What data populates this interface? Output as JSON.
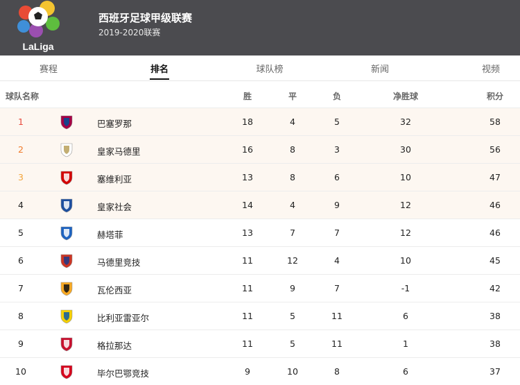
{
  "header": {
    "title": "西班牙足球甲级联赛",
    "season": "2019-2020联赛",
    "logo_text": "LaLiga"
  },
  "tabs": [
    {
      "label": "赛程",
      "active": false
    },
    {
      "label": "排名",
      "active": true
    },
    {
      "label": "球队榜",
      "active": false
    },
    {
      "label": "新闻",
      "active": false
    },
    {
      "label": "视频",
      "active": false
    }
  ],
  "columns": {
    "team": "球队名称",
    "win": "胜",
    "draw": "平",
    "loss": "负",
    "goal_diff": "净胜球",
    "points": "积分"
  },
  "colors": {
    "header_bg": "#4b4b4f",
    "rank_1": "#e8483c",
    "rank_2": "#f07a2a",
    "rank_3": "#f3a43a",
    "top_row_bg": "#fdf7f1"
  },
  "rows": [
    {
      "rank": "1",
      "team": "巴塞罗那",
      "crest": "barcelona-crest-icon",
      "w": "18",
      "d": "4",
      "l": "5",
      "gd": "32",
      "pts": "58"
    },
    {
      "rank": "2",
      "team": "皇家马德里",
      "crest": "real-madrid-crest-icon",
      "w": "16",
      "d": "8",
      "l": "3",
      "gd": "30",
      "pts": "56"
    },
    {
      "rank": "3",
      "team": "塞维利亚",
      "crest": "sevilla-crest-icon",
      "w": "13",
      "d": "8",
      "l": "6",
      "gd": "10",
      "pts": "47"
    },
    {
      "rank": "4",
      "team": "皇家社会",
      "crest": "real-sociedad-crest-icon",
      "w": "14",
      "d": "4",
      "l": "9",
      "gd": "12",
      "pts": "46"
    },
    {
      "rank": "5",
      "team": "赫塔菲",
      "crest": "getafe-crest-icon",
      "w": "13",
      "d": "7",
      "l": "7",
      "gd": "12",
      "pts": "46"
    },
    {
      "rank": "6",
      "team": "马德里竞技",
      "crest": "atletico-madrid-crest-icon",
      "w": "11",
      "d": "12",
      "l": "4",
      "gd": "10",
      "pts": "45"
    },
    {
      "rank": "7",
      "team": "瓦伦西亚",
      "crest": "valencia-crest-icon",
      "w": "11",
      "d": "9",
      "l": "7",
      "gd": "-1",
      "pts": "42"
    },
    {
      "rank": "8",
      "team": "比利亚雷亚尔",
      "crest": "villarreal-crest-icon",
      "w": "11",
      "d": "5",
      "l": "11",
      "gd": "6",
      "pts": "38"
    },
    {
      "rank": "9",
      "team": "格拉那达",
      "crest": "granada-crest-icon",
      "w": "11",
      "d": "5",
      "l": "11",
      "gd": "1",
      "pts": "38"
    },
    {
      "rank": "10",
      "team": "毕尔巴鄂竞技",
      "crest": "athletic-bilbao-crest-icon",
      "w": "9",
      "d": "10",
      "l": "8",
      "gd": "6",
      "pts": "37"
    }
  ]
}
